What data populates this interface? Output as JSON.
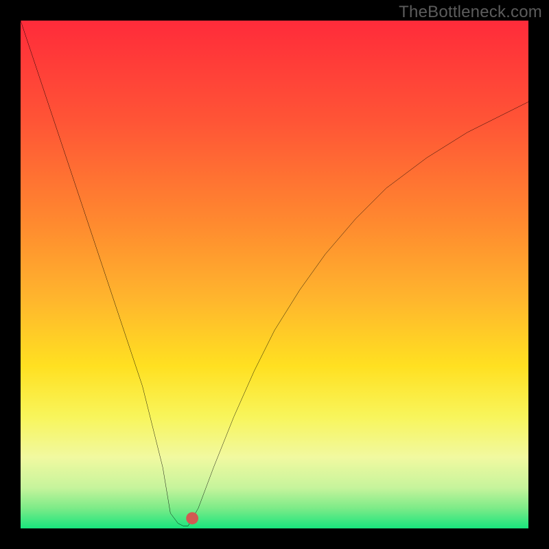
{
  "watermark": "TheBottleneck.com",
  "chart_data": {
    "type": "line",
    "title": "",
    "xlabel": "",
    "ylabel": "",
    "xlim": [
      0,
      100
    ],
    "ylim": [
      0,
      100
    ],
    "background": {
      "type": "vertical-gradient",
      "stops": [
        {
          "pos": 0,
          "color": "#ff2b3a"
        },
        {
          "pos": 20,
          "color": "#ff5536"
        },
        {
          "pos": 40,
          "color": "#ff8a2f"
        },
        {
          "pos": 55,
          "color": "#ffb62d"
        },
        {
          "pos": 68,
          "color": "#ffe021"
        },
        {
          "pos": 78,
          "color": "#f8f55b"
        },
        {
          "pos": 86,
          "color": "#f1f9a0"
        },
        {
          "pos": 92,
          "color": "#c6f49c"
        },
        {
          "pos": 96,
          "color": "#7deb88"
        },
        {
          "pos": 100,
          "color": "#18e57d"
        }
      ]
    },
    "series": [
      {
        "name": "bottleneck-curve",
        "color": "#000000",
        "x": [
          0,
          4,
          8,
          12,
          16,
          20,
          24,
          28,
          29.5,
          31,
          32,
          33,
          35,
          38,
          42,
          46,
          50,
          55,
          60,
          66,
          72,
          80,
          88,
          96,
          100
        ],
        "y": [
          100,
          88,
          76,
          64,
          52,
          40,
          28,
          12,
          3,
          1,
          0.5,
          0.5,
          4,
          12,
          22,
          31,
          39,
          47,
          54,
          61,
          67,
          73,
          78,
          82,
          84
        ]
      }
    ],
    "marker": {
      "name": "min-point",
      "x": 33.8,
      "y": 2.0,
      "color": "#d15a52",
      "radius_pct": 1.2
    }
  }
}
